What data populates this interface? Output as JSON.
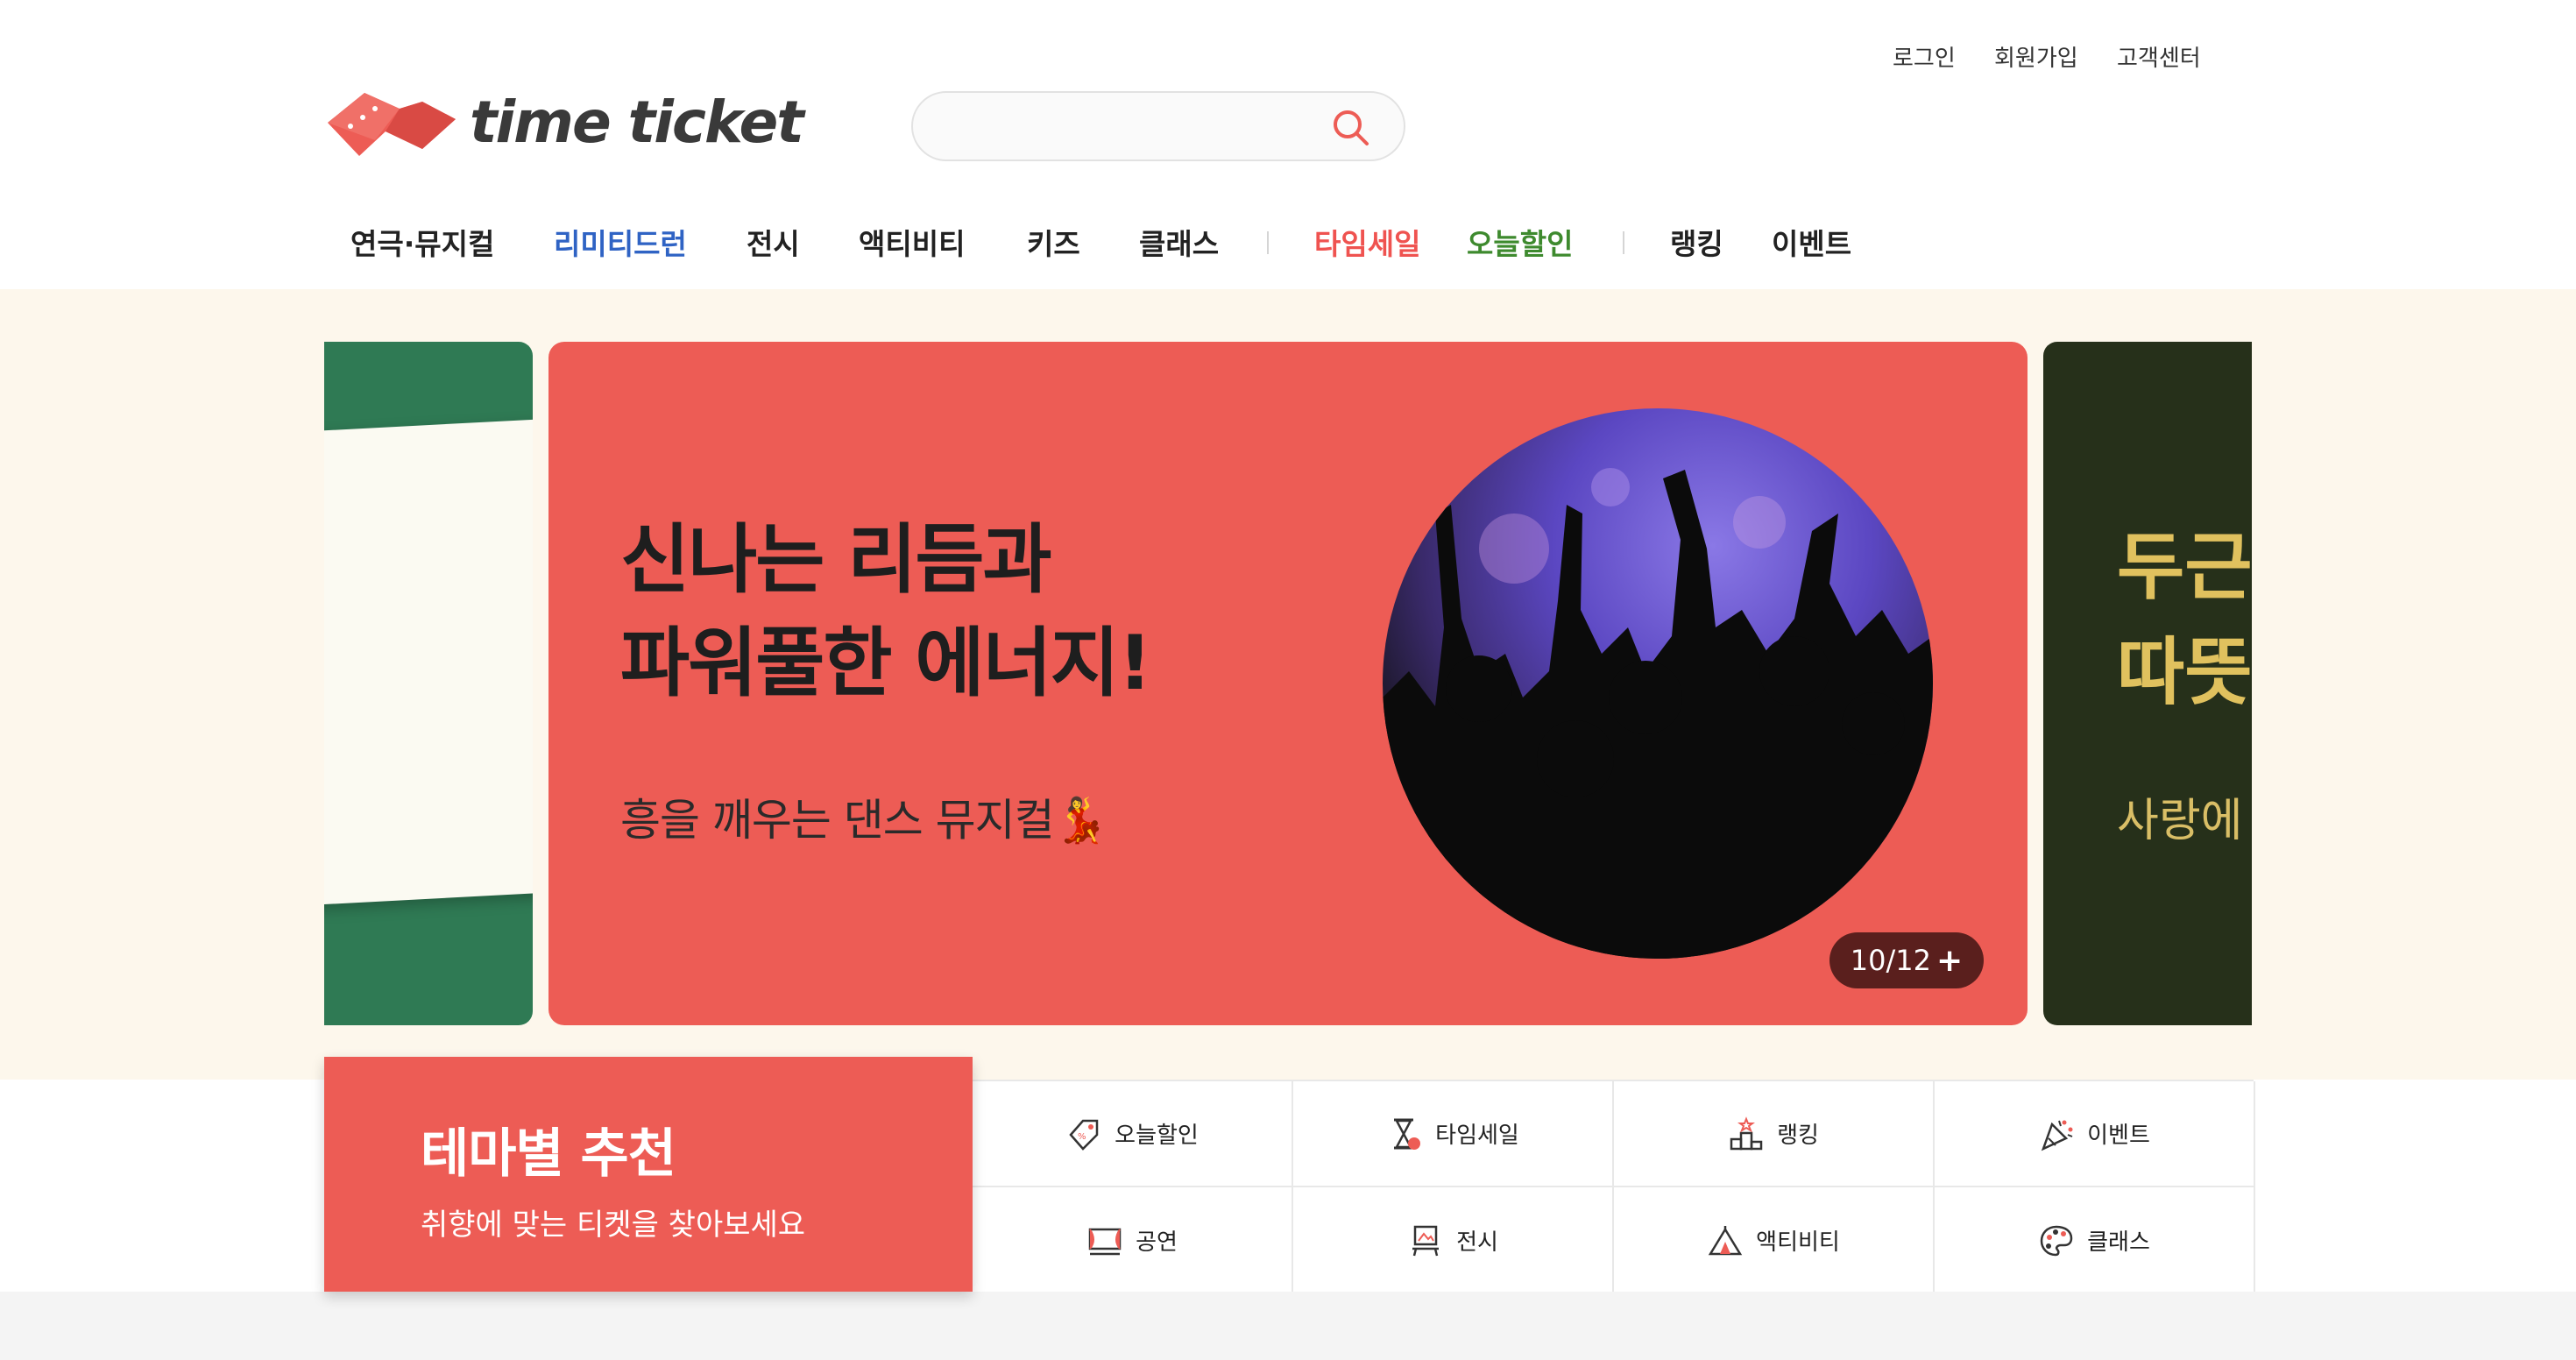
{
  "top_links": [
    "로그인",
    "회원가입",
    "고객센터"
  ],
  "logo": {
    "text": "time ticket"
  },
  "search": {
    "placeholder": ""
  },
  "nav": [
    {
      "label": "연극·뮤지컬",
      "style": "default"
    },
    {
      "label": "리미티드런",
      "style": "blue"
    },
    {
      "label": "전시",
      "style": "default"
    },
    {
      "label": "액티비티",
      "style": "default"
    },
    {
      "label": "키즈",
      "style": "default"
    },
    {
      "label": "클래스",
      "style": "default"
    },
    {
      "label": "타임세일",
      "style": "red"
    },
    {
      "label": "오늘할인",
      "style": "green"
    },
    {
      "label": "랭킹",
      "style": "default"
    },
    {
      "label": "이벤트",
      "style": "default"
    }
  ],
  "banner": {
    "headline_line1": "신나는 리듬과",
    "headline_line2": "파워풀한 에너지!",
    "subtitle": "흥을 깨우는 댄스 뮤지컬💃",
    "counter": "10/12",
    "counter_more": "+",
    "right_preview": [
      "두근",
      "따뜻",
      "사랑에"
    ]
  },
  "theme": {
    "title": "테마별 추천",
    "subtitle": "취향에 맞는 티켓을 찾아보세요",
    "items": [
      {
        "label": "오늘할인",
        "icon": "discount-tag-icon"
      },
      {
        "label": "타임세일",
        "icon": "hourglass-icon"
      },
      {
        "label": "랭킹",
        "icon": "podium-icon"
      },
      {
        "label": "이벤트",
        "icon": "party-popper-icon"
      },
      {
        "label": "공연",
        "icon": "theater-stage-icon"
      },
      {
        "label": "전시",
        "icon": "exhibition-easel-icon"
      },
      {
        "label": "액티비티",
        "icon": "tent-icon"
      },
      {
        "label": "클래스",
        "icon": "palette-icon"
      }
    ]
  },
  "colors": {
    "brand_red": "#ed5c55",
    "nav_blue": "#2f63c4",
    "nav_green": "#3e8a2e",
    "banner_bg": "#fdf7ec"
  }
}
